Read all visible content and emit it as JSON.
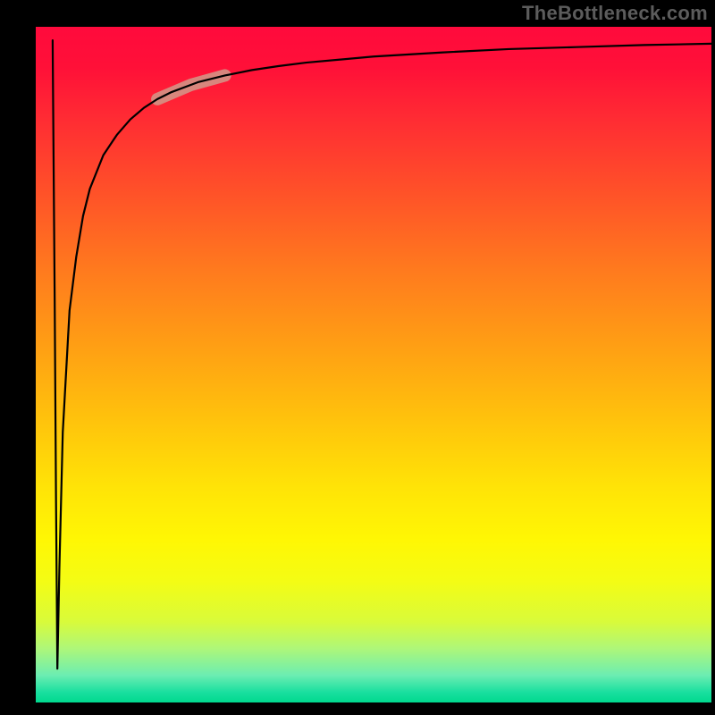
{
  "watermark": "TheBottleneck.com",
  "chart_data": {
    "type": "line",
    "title": "",
    "xlabel": "",
    "ylabel": "",
    "xlim": [
      0,
      100
    ],
    "ylim": [
      0,
      100
    ],
    "grid": false,
    "legend": false,
    "background_gradient": {
      "direction": "vertical",
      "stops": [
        {
          "pos": 0.0,
          "color": "#ff0a3c"
        },
        {
          "pos": 0.25,
          "color": "#ff5328"
        },
        {
          "pos": 0.5,
          "color": "#ffb010"
        },
        {
          "pos": 0.75,
          "color": "#fff406"
        },
        {
          "pos": 0.92,
          "color": "#aef779"
        },
        {
          "pos": 1.0,
          "color": "#00d98e"
        }
      ]
    },
    "series": [
      {
        "name": "curve",
        "color": "#000000",
        "stroke_width": 2,
        "x": [
          2.5,
          2.8,
          3.0,
          3.2,
          3.5,
          4.0,
          5.0,
          6.0,
          7.0,
          8.0,
          10.0,
          12.0,
          14.0,
          16.0,
          18.0,
          20.0,
          24.0,
          28.0,
          32.0,
          36.0,
          40.0,
          50.0,
          60.0,
          70.0,
          80.0,
          90.0,
          100.0
        ],
        "y": [
          98.0,
          60.0,
          30.0,
          5.0,
          20.0,
          40.0,
          58.0,
          66.0,
          72.0,
          76.0,
          81.0,
          84.0,
          86.3,
          88.0,
          89.3,
          90.3,
          91.8,
          92.8,
          93.6,
          94.2,
          94.7,
          95.6,
          96.2,
          96.7,
          97.0,
          97.3,
          97.5
        ]
      }
    ],
    "annotations": [
      {
        "type": "segment-highlight",
        "color": "#d19a8a",
        "opacity": 0.85,
        "stroke_width": 14,
        "x_range": [
          18,
          28
        ],
        "y_range": [
          89,
          93
        ],
        "note": "rounded capsule highlight over curve segment"
      }
    ]
  }
}
